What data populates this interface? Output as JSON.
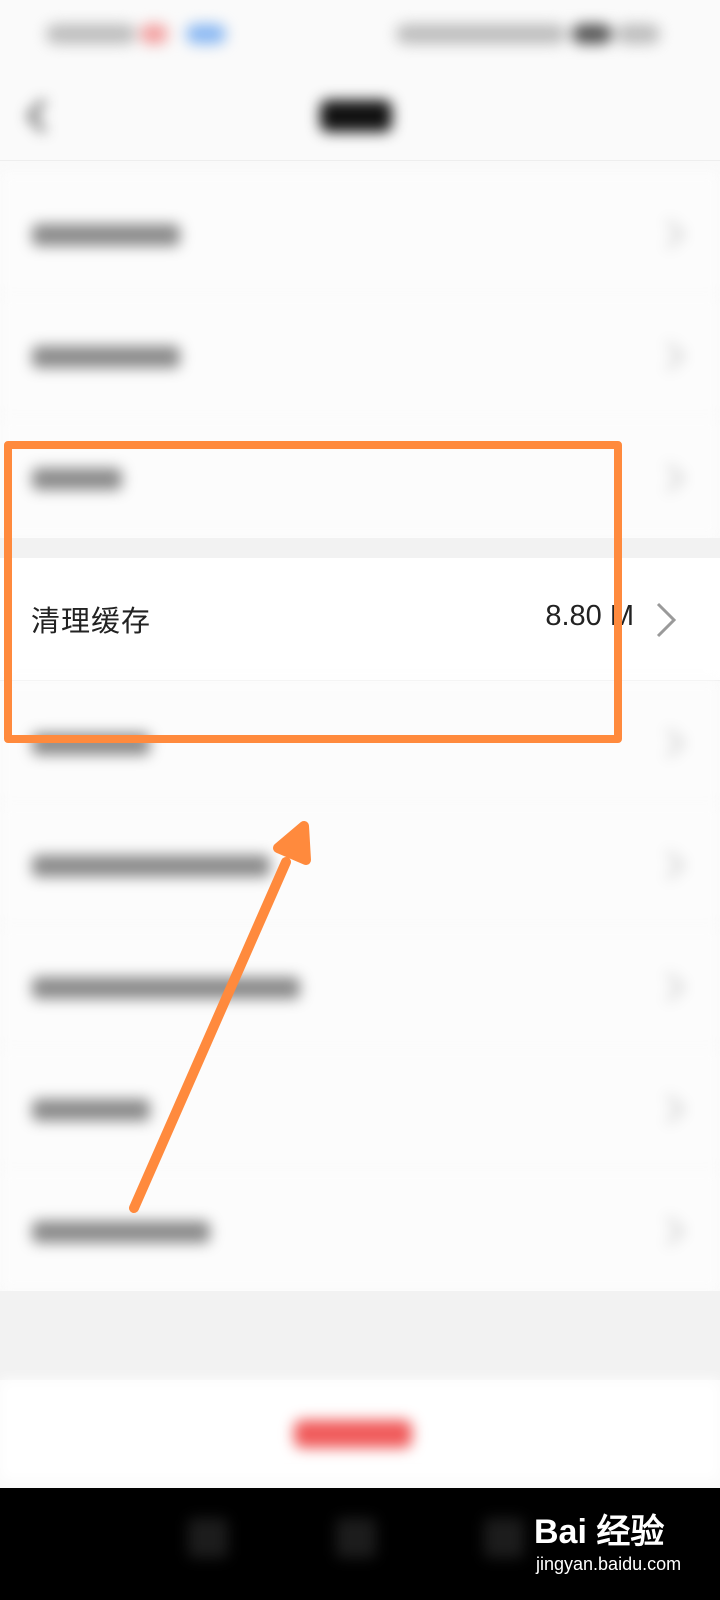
{
  "cache_row": {
    "label": "清理缓存",
    "size": "8.80 M"
  },
  "watermark": {
    "line1": "Bai 经验",
    "line2": "jingyan.baidu.com"
  },
  "colors": {
    "highlight": "#ff8a3d",
    "logout": "#f05a5a"
  }
}
